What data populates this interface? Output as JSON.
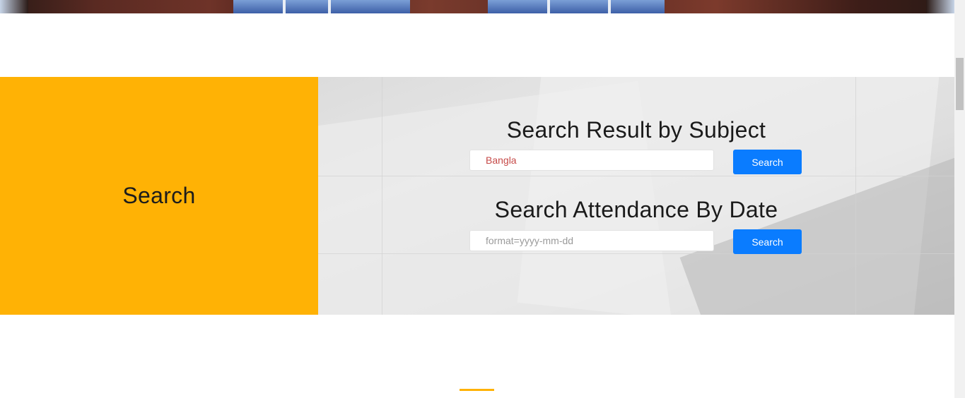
{
  "search_panel": {
    "heading": "Search"
  },
  "subject_form": {
    "title": "Search Result by Subject",
    "input_value": "Bangla",
    "button_label": "Search"
  },
  "attendance_form": {
    "title": "Search Attendance By Date",
    "input_placeholder": "format=yyyy-mm-dd",
    "button_label": "Search"
  },
  "colors": {
    "accent_yellow": "#ffb205",
    "button_blue": "#0a7cff",
    "input_text_red": "#c64a48"
  }
}
